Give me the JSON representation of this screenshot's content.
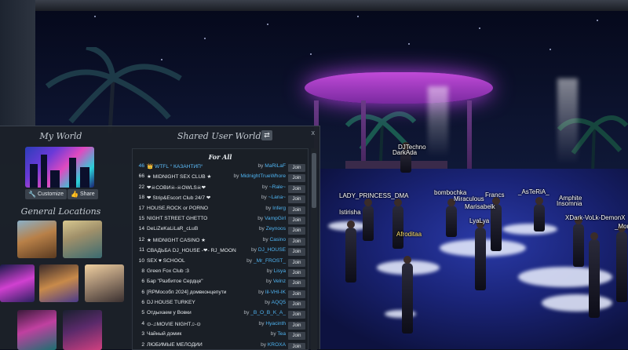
{
  "panel": {
    "close_label": "x",
    "my_world": {
      "title": "My World",
      "customize_label": "Customize",
      "share_label": "Share"
    },
    "general_locations": {
      "title": "General Locations"
    },
    "shared": {
      "title": "Shared User Worlds",
      "refresh_icon": "refresh-icon",
      "refresh_glyph": "⇄",
      "section_label": "For All",
      "by_prefix": "by",
      "join_label": "Join",
      "worlds": [
        {
          "count": "46",
          "name": "👑 WTFL ° КАЗАНТИП°",
          "owner": "MaRiLaF",
          "highlight": true
        },
        {
          "count": "66",
          "name": "★ MIDNIGHT SEX CLUB ★",
          "owner": "MidnightTrueWhore",
          "highlight": false
        },
        {
          "count": "22",
          "name": "❤☠СОВИ☠-☠OWLS☠❤",
          "owner": "~Rale~",
          "highlight": false
        },
        {
          "count": "18",
          "name": "❤ Strip&Escort Club 24/7 ❤",
          "owner": "~Lana~",
          "highlight": false
        },
        {
          "count": "17",
          "name": "HOUSE.ROCK or PORNO",
          "owner": "Inferg",
          "highlight": false
        },
        {
          "count": "15",
          "name": "NIGHT STREET GHETTO",
          "owner": "VampGirl",
          "highlight": false
        },
        {
          "count": "14",
          "name": "DeLiZeKaLiLaR_cLuB",
          "owner": "Zeynoos",
          "highlight": false
        },
        {
          "count": "12",
          "name": "★ MIDNIGHT CASINO ★",
          "owner": "Casino",
          "highlight": false
        },
        {
          "count": "11",
          "name": "СВАДЬБА DJ_HOUSE -❤- RJ_MOON",
          "owner": "DJ_HOUSE",
          "highlight": false
        },
        {
          "count": "10",
          "name": "SEX ♥ SCHOOL",
          "owner": "_Mr_FROST_",
          "highlight": false
        },
        {
          "count": "8",
          "name": "Green Fox Club :3",
          "owner": "Lisya",
          "highlight": false
        },
        {
          "count": "6",
          "name": "Бар \"Разбитое Сердце\"",
          "owner": "Velnz",
          "highlight": false
        },
        {
          "count": "6",
          "name": "[RPMособп 2024] домвконцепути",
          "owner": "lil-VHI-IK",
          "highlight": false
        },
        {
          "count": "6",
          "name": "DJ HOUSE TURKEY",
          "owner": "AQQ5",
          "highlight": false
        },
        {
          "count": "5",
          "name": "Отдыхаем у Вовки",
          "owner": "_B_O_B_K_A_",
          "highlight": false
        },
        {
          "count": "4",
          "name": "⊙-♫MOVIE NIGHT♫-⊙",
          "owner": "Hyacinth",
          "highlight": false
        },
        {
          "count": "3",
          "name": "Чайный домик",
          "owner": "Tea",
          "highlight": false
        },
        {
          "count": "2",
          "name": "ЛЮБИМЫЕ МЕЛОДИИ",
          "owner": "KROXA",
          "highlight": false
        }
      ]
    }
  },
  "scene": {
    "nametags": [
      {
        "text": "DJTechno",
        "color": "white"
      },
      {
        "text": "DarkAda",
        "color": "white"
      },
      {
        "text": "LADY_PRINCESS_DMA",
        "color": "white"
      },
      {
        "text": "bombochka",
        "color": "white"
      },
      {
        "text": "Miraculous",
        "color": "white"
      },
      {
        "text": "Francs",
        "color": "white"
      },
      {
        "text": "_AsTeRiA_",
        "color": "white"
      },
      {
        "text": "Amphite",
        "color": "white"
      },
      {
        "text": "Insomnia",
        "color": "white"
      },
      {
        "text": "Istirisha",
        "color": "white"
      },
      {
        "text": "Marisabelk",
        "color": "white"
      },
      {
        "text": "LyaLya",
        "color": "white"
      },
      {
        "text": "XDark-VoLk-DemonX",
        "color": "white"
      },
      {
        "text": "Afroditaa",
        "color": "yellow"
      },
      {
        "text": "_Mor",
        "color": "white"
      }
    ]
  }
}
